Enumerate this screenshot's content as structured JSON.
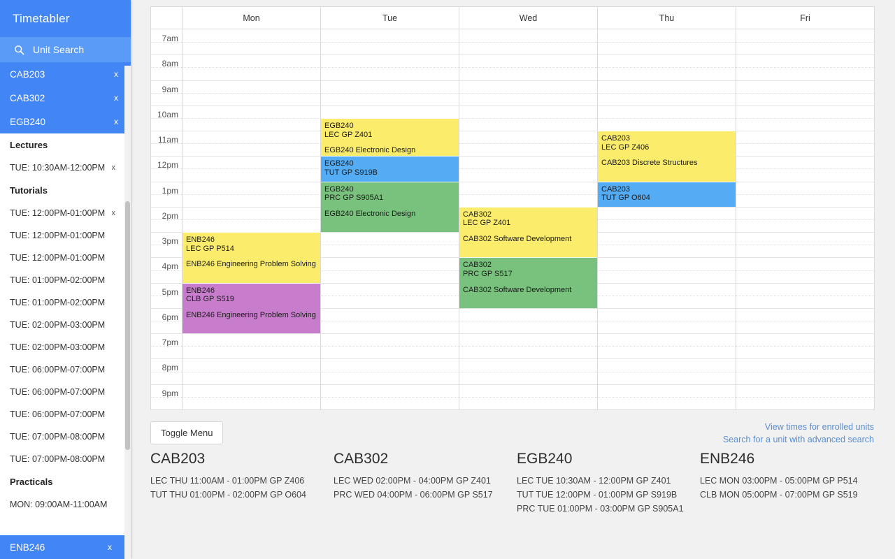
{
  "sidebar": {
    "title": "Timetabler",
    "search": {
      "label": "Unit Search",
      "icon": "search-icon"
    },
    "units": [
      {
        "code": "CAB203",
        "remove": "x"
      },
      {
        "code": "CAB302",
        "remove": "x"
      },
      {
        "code": "EGB240",
        "remove": "x"
      }
    ],
    "sections": [
      {
        "heading": "Lectures",
        "rows": [
          {
            "time": "TUE: 10:30AM-12:00PM",
            "remove": "x"
          }
        ]
      },
      {
        "heading": "Tutorials",
        "rows": [
          {
            "time": "TUE: 12:00PM-01:00PM",
            "remove": "x"
          },
          {
            "time": "TUE: 12:00PM-01:00PM",
            "remove": ""
          },
          {
            "time": "TUE: 12:00PM-01:00PM",
            "remove": ""
          },
          {
            "time": "TUE: 01:00PM-02:00PM",
            "remove": ""
          },
          {
            "time": "TUE: 01:00PM-02:00PM",
            "remove": ""
          },
          {
            "time": "TUE: 02:00PM-03:00PM",
            "remove": ""
          },
          {
            "time": "TUE: 02:00PM-03:00PM",
            "remove": ""
          },
          {
            "time": "TUE: 06:00PM-07:00PM",
            "remove": ""
          },
          {
            "time": "TUE: 06:00PM-07:00PM",
            "remove": ""
          },
          {
            "time": "TUE: 06:00PM-07:00PM",
            "remove": ""
          },
          {
            "time": "TUE: 07:00PM-08:00PM",
            "remove": ""
          },
          {
            "time": "TUE: 07:00PM-08:00PM",
            "remove": ""
          }
        ]
      },
      {
        "heading": "Practicals",
        "rows": [
          {
            "time": "MON: 09:00AM-11:00AM",
            "remove": ""
          }
        ]
      }
    ],
    "bottom_unit": {
      "code": "ENB246",
      "remove": "x"
    }
  },
  "calendar": {
    "days": [
      "Mon",
      "Tue",
      "Wed",
      "Thu",
      "Fri"
    ],
    "hours": [
      "7am",
      "8am",
      "9am",
      "10am",
      "11am",
      "12pm",
      "1pm",
      "2pm",
      "3pm",
      "4pm",
      "5pm",
      "6pm",
      "7pm",
      "8pm",
      "9pm"
    ],
    "colors": {
      "lecture": "#fbec6b",
      "tutorial": "#54acf5",
      "practical": "#78c27d",
      "club": "#c77ccc"
    },
    "events": [
      {
        "day": 0,
        "start": 15.0,
        "end": 17.0,
        "type": "lecture",
        "code": "ENB246",
        "place": "LEC GP P514",
        "desc": "ENB246 Engineering Problem Solving"
      },
      {
        "day": 0,
        "start": 17.0,
        "end": 19.0,
        "type": "club",
        "code": "ENB246",
        "place": "CLB GP S519",
        "desc": "ENB246 Engineering Problem Solving"
      },
      {
        "day": 1,
        "start": 10.5,
        "end": 12.0,
        "type": "lecture",
        "code": "EGB240",
        "place": "LEC GP Z401",
        "desc": "EGB240 Electronic Design"
      },
      {
        "day": 1,
        "start": 12.0,
        "end": 13.0,
        "type": "tutorial",
        "code": "EGB240",
        "place": "TUT GP S919B",
        "desc": ""
      },
      {
        "day": 1,
        "start": 13.0,
        "end": 15.0,
        "type": "practical",
        "code": "EGB240",
        "place": "PRC GP S905A1",
        "desc": "EGB240 Electronic Design"
      },
      {
        "day": 2,
        "start": 14.0,
        "end": 16.0,
        "type": "lecture",
        "code": "CAB302",
        "place": "LEC GP Z401",
        "desc": "CAB302 Software Development"
      },
      {
        "day": 2,
        "start": 16.0,
        "end": 18.0,
        "type": "practical",
        "code": "CAB302",
        "place": "PRC GP S517",
        "desc": "CAB302 Software Development"
      },
      {
        "day": 3,
        "start": 11.0,
        "end": 13.0,
        "type": "lecture",
        "code": "CAB203",
        "place": "LEC GP Z406",
        "desc": "CAB203 Discrete Structures"
      },
      {
        "day": 3,
        "start": 13.0,
        "end": 14.0,
        "type": "tutorial",
        "code": "CAB203",
        "place": "TUT GP O604",
        "desc": ""
      }
    ]
  },
  "toolbar": {
    "toggle_menu_label": "Toggle Menu"
  },
  "links": [
    {
      "label": "View times for enrolled units"
    },
    {
      "label": "Search for a unit with advanced search"
    }
  ],
  "summaries": [
    {
      "unit": "CAB203",
      "lines": [
        "LEC THU 11:00AM - 01:00PM GP Z406",
        "TUT THU 01:00PM - 02:00PM GP O604"
      ]
    },
    {
      "unit": "CAB302",
      "lines": [
        "LEC WED 02:00PM - 04:00PM GP Z401",
        "PRC WED 04:00PM - 06:00PM GP S517"
      ]
    },
    {
      "unit": "EGB240",
      "lines": [
        "LEC TUE 10:30AM - 12:00PM GP Z401",
        "TUT TUE 12:00PM - 01:00PM GP S919B",
        "PRC TUE 01:00PM - 03:00PM GP S905A1"
      ]
    },
    {
      "unit": "ENB246",
      "lines": [
        "LEC MON 03:00PM - 05:00PM GP P514",
        "CLB MON 05:00PM - 07:00PM GP S519"
      ]
    }
  ]
}
